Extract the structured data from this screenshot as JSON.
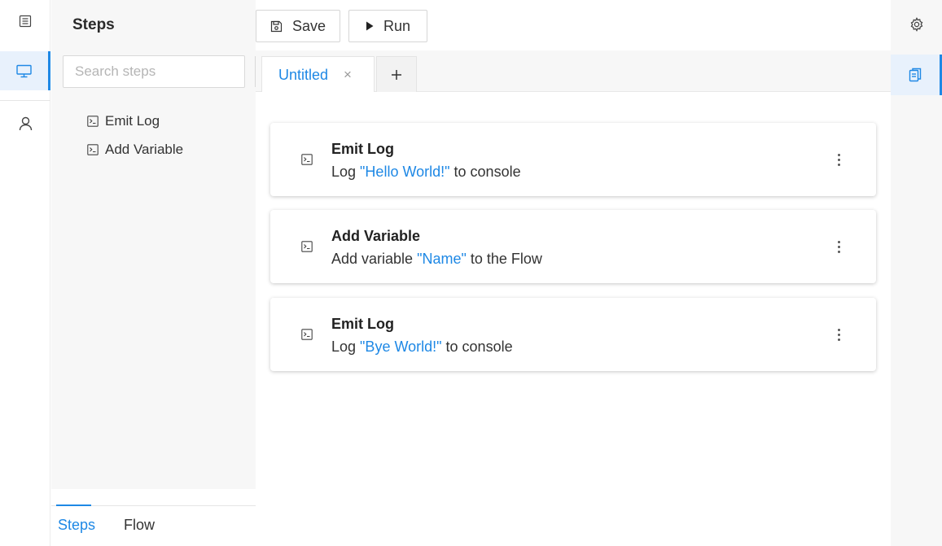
{
  "rail": {
    "items": [
      {
        "name": "list-icon",
        "active": false
      },
      {
        "name": "monitor-icon",
        "active": true
      },
      {
        "name": "user-icon",
        "active": false
      }
    ]
  },
  "steps_panel": {
    "title": "Steps",
    "search": {
      "placeholder": "Search steps",
      "value": ""
    },
    "items": [
      {
        "label": "Emit Log",
        "icon": "terminal-icon"
      },
      {
        "label": "Add Variable",
        "icon": "terminal-icon"
      }
    ],
    "bottom_tabs": [
      {
        "label": "Steps",
        "active": true
      },
      {
        "label": "Flow",
        "active": false
      }
    ]
  },
  "toolbar": {
    "save_label": "Save",
    "run_label": "Run"
  },
  "tabs": [
    {
      "label": "Untitled",
      "active": true,
      "close": "×"
    }
  ],
  "add_tab": "+",
  "cards": [
    {
      "title": "Emit Log",
      "prefix": "Log ",
      "highlight": "\"Hello World!\"",
      "suffix": " to console"
    },
    {
      "title": "Add Variable",
      "prefix": "Add variable ",
      "highlight": "\"Name\"",
      "suffix": " to the Flow"
    },
    {
      "title": "Emit Log",
      "prefix": "Log ",
      "highlight": "\"Bye World!\"",
      "suffix": " to console"
    }
  ],
  "right_rail": {
    "items": [
      {
        "name": "gear-icon",
        "active": false
      },
      {
        "name": "clipboard-icon",
        "active": true
      }
    ]
  },
  "colors": {
    "accent": "#1e88e5",
    "panel_bg": "#f7f7f7"
  }
}
